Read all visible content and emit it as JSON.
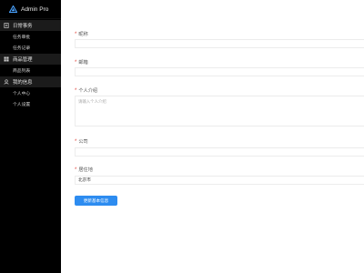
{
  "app": {
    "title": "Admin Pro"
  },
  "sidebar": {
    "groups": [
      {
        "label": "日常事务",
        "items": [
          {
            "label": "任务审批"
          },
          {
            "label": "任务记录"
          }
        ]
      },
      {
        "label": "商品管理",
        "items": [
          {
            "label": "商品列表"
          }
        ]
      },
      {
        "label": "我的信息",
        "items": [
          {
            "label": "个人中心"
          },
          {
            "label": "个人设置"
          }
        ]
      }
    ]
  },
  "form": {
    "nickname": {
      "label": "昵称",
      "value": ""
    },
    "email": {
      "label": "邮箱",
      "value": ""
    },
    "bio": {
      "label": "个人介绍",
      "placeholder": "请输入个人介绍"
    },
    "company": {
      "label": "公司",
      "value": ""
    },
    "city": {
      "label": "居住地",
      "value": "北京市"
    },
    "submit_label": "更新基本信息"
  },
  "colors": {
    "accent": "#2d8cf0",
    "sidebar_bg": "#000000",
    "required": "#e0463c"
  }
}
